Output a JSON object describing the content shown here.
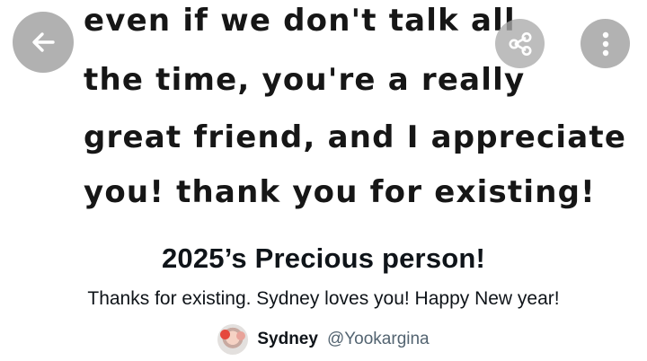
{
  "image_text": {
    "line1": "even if we don't talk all",
    "line2": "the time, you're a really",
    "line3": "great friend, and I appreciate",
    "line4": "you! thank you for existing!"
  },
  "header": {
    "back_icon": "arrow-left-icon",
    "share_icon": "share-icon",
    "more_icon": "more-vertical-icon"
  },
  "card": {
    "title": "2025’s Precious person!",
    "description": "Thanks for existing. Sydney loves you! Happy New year!"
  },
  "author": {
    "name": "Sydney",
    "handle": "@Yookargina"
  },
  "colors": {
    "button_overlay": "#a8a8a8",
    "text_primary": "#0f1419",
    "text_secondary": "#536471"
  }
}
